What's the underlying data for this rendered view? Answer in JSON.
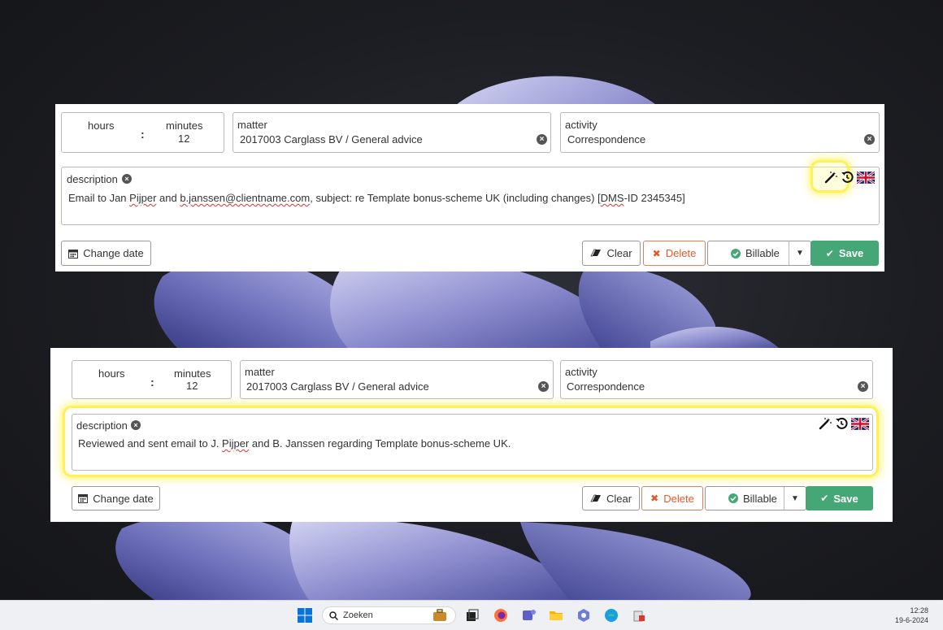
{
  "window_top": {
    "hours_label": "hours",
    "minutes_label": "minutes",
    "minutes_value": "12",
    "colon": ":",
    "matter_label": "matter",
    "matter_value": "2017003 Carglass BV / General advice",
    "activity_label": "activity",
    "activity_value": "Correspondence",
    "description_label": "description",
    "description_parts": [
      "Email to Jan ",
      "Pijper",
      " and ",
      "b.janssen@clientname.com",
      ", subject: re Template bonus-scheme UK (including changes) [",
      "DMS",
      "-ID 2345345]"
    ],
    "change_date_label": "Change date",
    "clear_label": "Clear",
    "delete_label": "Delete",
    "billable_label": "Billable",
    "save_label": "Save"
  },
  "window_bottom": {
    "hours_label": "hours",
    "minutes_label": "minutes",
    "minutes_value": "12",
    "colon": ":",
    "matter_label": "matter",
    "matter_value": "2017003 Carglass BV / General advice",
    "activity_label": "activity",
    "activity_value": "Correspondence",
    "description_label": "description",
    "description_parts": [
      "Reviewed and sent email to J. ",
      "Pijper",
      " and B. Janssen regarding Template bonus-scheme UK."
    ],
    "change_date_label": "Change date",
    "clear_label": "Clear",
    "delete_label": "Delete",
    "billable_label": "Billable",
    "save_label": "Save"
  },
  "taskbar": {
    "search_placeholder": "Zoeken",
    "time": "12:28",
    "date": "19-6-2024"
  },
  "colors": {
    "save": "#45a676",
    "delete": "#e05a2c",
    "highlight": "#fff03c"
  },
  "icons": [
    "calendar-icon",
    "eraser-icon",
    "times-icon",
    "check-circle-icon",
    "check-icon",
    "magic-wand-icon",
    "undo-icon",
    "uk-flag-icon",
    "windows-start-icon",
    "search-icon"
  ]
}
